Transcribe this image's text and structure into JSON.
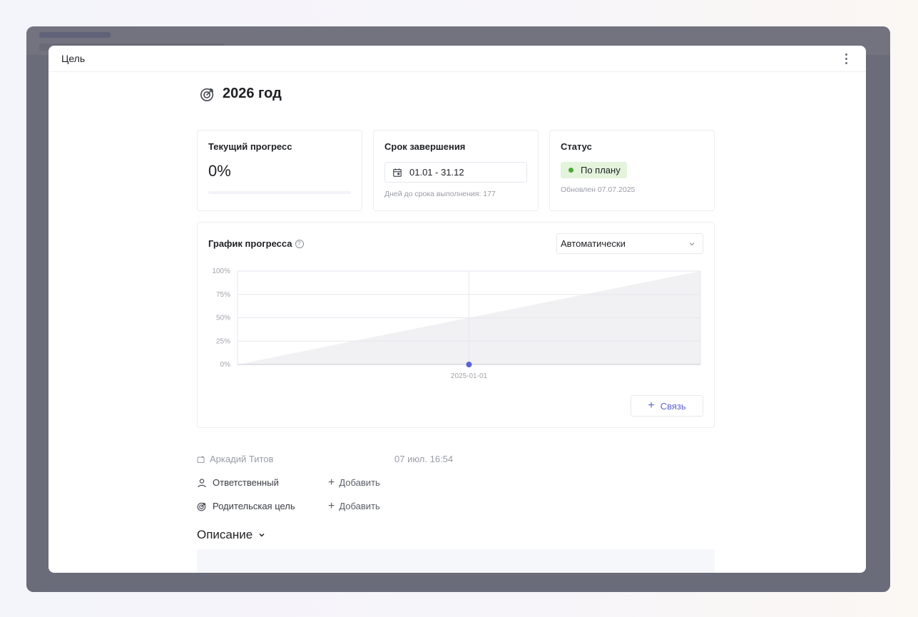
{
  "modal": {
    "title": "Цель"
  },
  "goal": {
    "title": "2026 год"
  },
  "cards": {
    "progress": {
      "label": "Текущий прогресс",
      "value": "0%",
      "percent": 0
    },
    "deadline": {
      "label": "Срок завершения",
      "range": "01.01 - 31.12",
      "hint": "Дней до срока выполнения: 177"
    },
    "status": {
      "label": "Статус",
      "value": "По плану",
      "updated": "Обновлен 07.07.2025"
    }
  },
  "chart_section": {
    "title": "График прогресса",
    "help": "?",
    "mode_select": "Автоматически",
    "link_button": "Связь"
  },
  "chart_data": {
    "type": "area",
    "yticks": [
      "100%",
      "75%",
      "50%",
      "25%",
      "0%"
    ],
    "ylim": [
      0,
      100
    ],
    "xtick": "2025-01-01",
    "x_domain": [
      "2025-07-07",
      "2026-12-31"
    ],
    "planned": {
      "x": [
        "2025-07-07",
        "2026-12-31"
      ],
      "y": [
        0,
        100
      ]
    },
    "actual": {
      "x": [
        "2025-01-01"
      ],
      "y": [
        0
      ]
    },
    "grid": true
  },
  "meta": {
    "author": "Аркадий Титов",
    "created": "07 июл. 16:54",
    "responsible_label": "Ответственный",
    "responsible_add": "Добавить",
    "parent_label": "Родительская цель",
    "parent_add": "Добавить"
  },
  "description": {
    "header": "Описание"
  },
  "colors": {
    "accent": "#5b63d3",
    "status_bg": "#e3f3dc",
    "status_dot": "#4fa63a"
  }
}
